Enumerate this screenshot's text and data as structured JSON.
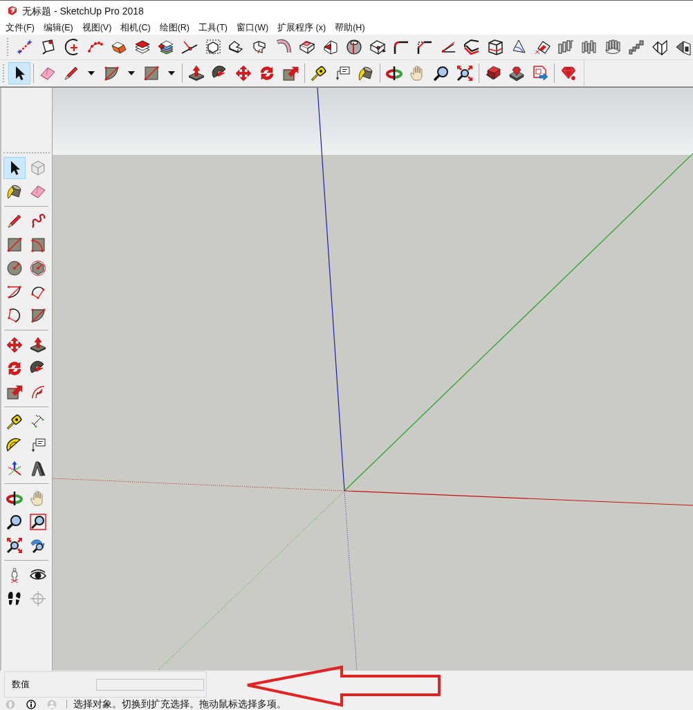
{
  "window": {
    "title": "无标题 - SketchUp Pro 2018"
  },
  "menu_bar": [
    {
      "label": "文件(F)"
    },
    {
      "label": "编辑(E)"
    },
    {
      "label": "视图(V)"
    },
    {
      "label": "相机(C)"
    },
    {
      "label": "绘图(R)"
    },
    {
      "label": "工具(T)"
    },
    {
      "label": "窗口(W)"
    },
    {
      "label": "扩展程序 (x)"
    },
    {
      "label": "帮助(H)"
    }
  ],
  "toolbars": [
    {
      "items": [
        {
          "kind": "connect",
          "selected": false
        },
        {
          "kind": "pin",
          "selected": false
        },
        {
          "kind": "arcplus",
          "selected": false
        },
        {
          "kind": "curve",
          "selected": false
        },
        {
          "kind": "box",
          "selected": false
        },
        {
          "kind": "layers",
          "selected": false
        },
        {
          "kind": "colorlayers",
          "selected": false
        },
        {
          "kind": "cross",
          "selected": false
        },
        {
          "kind": "dashedpoly",
          "selected": false
        },
        {
          "kind": "fold",
          "selected": false
        },
        {
          "kind": "profile",
          "selected": false
        },
        {
          "kind": "pipe",
          "selected": false
        },
        {
          "kind": "boxoutline",
          "selected": false
        },
        {
          "kind": "wedge",
          "selected": false
        },
        {
          "kind": "sphere",
          "selected": false
        },
        {
          "kind": "cubedot",
          "selected": false
        },
        {
          "kind": "fillet",
          "selected": false
        },
        {
          "kind": "chamfer",
          "selected": false
        },
        {
          "kind": "angle",
          "selected": false
        },
        {
          "kind": "offsetedge",
          "selected": false
        },
        {
          "kind": "frame",
          "selected": false
        },
        {
          "kind": "sail",
          "selected": false
        },
        {
          "kind": "tiltsquare",
          "selected": false
        },
        {
          "kind": "columns",
          "selected": false
        },
        {
          "kind": "grid",
          "selected": false
        },
        {
          "kind": "ring",
          "selected": false
        },
        {
          "kind": "stairs",
          "selected": false
        },
        {
          "kind": "sheet",
          "selected": false
        },
        {
          "kind": "boxedge",
          "selected": false
        }
      ]
    },
    {
      "items": [
        {
          "kind": "select",
          "selected": true
        },
        {
          "kind": "separator"
        },
        {
          "kind": "eraser",
          "selected": false
        },
        {
          "kind": "pencil",
          "selected": false
        },
        {
          "kind": "dropdown"
        },
        {
          "kind": "pie",
          "selected": false
        },
        {
          "kind": "dropdown"
        },
        {
          "kind": "rectangle",
          "selected": false
        },
        {
          "kind": "dropdown"
        },
        {
          "kind": "separator"
        },
        {
          "kind": "pushpull",
          "selected": false
        },
        {
          "kind": "followme",
          "selected": false
        },
        {
          "kind": "move",
          "selected": false
        },
        {
          "kind": "rotate",
          "selected": false
        },
        {
          "kind": "scale",
          "selected": false
        },
        {
          "kind": "separator"
        },
        {
          "kind": "tape",
          "selected": false
        },
        {
          "kind": "text",
          "selected": false
        },
        {
          "kind": "paint",
          "selected": false
        },
        {
          "kind": "separator"
        },
        {
          "kind": "orbit",
          "selected": false
        },
        {
          "kind": "pan",
          "selected": false
        },
        {
          "kind": "zoom",
          "selected": false
        },
        {
          "kind": "extents",
          "selected": false
        },
        {
          "kind": "separator"
        },
        {
          "kind": "warehouse",
          "selected": false
        },
        {
          "kind": "extensions",
          "selected": false
        },
        {
          "kind": "export",
          "selected": false
        },
        {
          "kind": "separator"
        },
        {
          "kind": "ruby",
          "selected": false
        }
      ]
    }
  ],
  "tool_palette": {
    "items": [
      {
        "kind": "select",
        "selected": true
      },
      {
        "kind": "component",
        "selected": false
      },
      {
        "kind": "paint",
        "selected": false
      },
      {
        "kind": "eraser",
        "selected": false
      },
      {
        "kind": "separator"
      },
      {
        "kind": "pencil",
        "selected": false
      },
      {
        "kind": "freehand",
        "selected": false
      },
      {
        "kind": "rectangle",
        "selected": false
      },
      {
        "kind": "rotrect",
        "selected": false
      },
      {
        "kind": "circle",
        "selected": false
      },
      {
        "kind": "polygon",
        "selected": false
      },
      {
        "kind": "arc",
        "selected": false
      },
      {
        "kind": "arc3",
        "selected": false
      },
      {
        "kind": "arc2",
        "selected": false
      },
      {
        "kind": "pie",
        "selected": false
      },
      {
        "kind": "separator"
      },
      {
        "kind": "move",
        "selected": false
      },
      {
        "kind": "pushpull",
        "selected": false
      },
      {
        "kind": "rotate",
        "selected": false
      },
      {
        "kind": "followme",
        "selected": false
      },
      {
        "kind": "scale",
        "selected": false
      },
      {
        "kind": "offset",
        "selected": false
      },
      {
        "kind": "separator"
      },
      {
        "kind": "tape",
        "selected": false
      },
      {
        "kind": "dimension",
        "selected": false
      },
      {
        "kind": "protractor",
        "selected": false
      },
      {
        "kind": "text",
        "selected": false
      },
      {
        "kind": "axes",
        "selected": false
      },
      {
        "kind": "text3d",
        "selected": false
      },
      {
        "kind": "separator"
      },
      {
        "kind": "orbit",
        "selected": false
      },
      {
        "kind": "pan",
        "selected": false
      },
      {
        "kind": "zoom",
        "selected": false
      },
      {
        "kind": "zoomwin",
        "selected": false
      },
      {
        "kind": "extents",
        "selected": false
      },
      {
        "kind": "previous",
        "selected": false
      },
      {
        "kind": "separator"
      },
      {
        "kind": "camera",
        "selected": false
      },
      {
        "kind": "look",
        "selected": false
      },
      {
        "kind": "walk",
        "selected": false
      },
      {
        "kind": "section",
        "selected": false
      }
    ]
  },
  "measurements": {
    "label": "数值"
  },
  "status_bar": {
    "text": "选择对象。切换到扩充选择。拖动鼠标选择多项。"
  }
}
